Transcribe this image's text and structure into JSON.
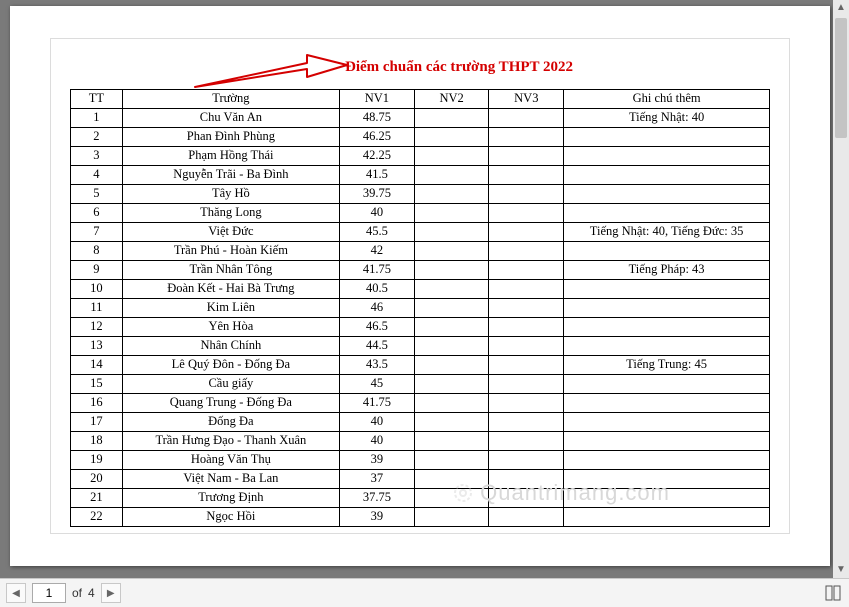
{
  "title": "Điểm chuẩn các trường THPT 2022",
  "headers": {
    "tt": "TT",
    "school": "Trường",
    "nv1": "NV1",
    "nv2": "NV2",
    "nv3": "NV3",
    "note": "Ghi chú thêm"
  },
  "rows": [
    {
      "tt": "1",
      "school": "Chu Văn An",
      "nv1": "48.75",
      "nv2": "",
      "nv3": "",
      "note": "Tiếng Nhật: 40"
    },
    {
      "tt": "2",
      "school": "Phan Đình Phùng",
      "nv1": "46.25",
      "nv2": "",
      "nv3": "",
      "note": ""
    },
    {
      "tt": "3",
      "school": "Phạm Hồng Thái",
      "nv1": "42.25",
      "nv2": "",
      "nv3": "",
      "note": ""
    },
    {
      "tt": "4",
      "school": "Nguyễn Trãi - Ba Đình",
      "nv1": "41.5",
      "nv2": "",
      "nv3": "",
      "note": ""
    },
    {
      "tt": "5",
      "school": "Tây Hồ",
      "nv1": "39.75",
      "nv2": "",
      "nv3": "",
      "note": ""
    },
    {
      "tt": "6",
      "school": "Thăng Long",
      "nv1": "40",
      "nv2": "",
      "nv3": "",
      "note": ""
    },
    {
      "tt": "7",
      "school": "Việt Đức",
      "nv1": "45.5",
      "nv2": "",
      "nv3": "",
      "note": "Tiếng Nhật: 40, Tiếng Đức: 35"
    },
    {
      "tt": "8",
      "school": "Trần Phú - Hoàn Kiếm",
      "nv1": "42",
      "nv2": "",
      "nv3": "",
      "note": ""
    },
    {
      "tt": "9",
      "school": "Trần Nhân Tông",
      "nv1": "41.75",
      "nv2": "",
      "nv3": "",
      "note": "Tiếng Pháp: 43"
    },
    {
      "tt": "10",
      "school": "Đoàn Kết - Hai Bà Trưng",
      "nv1": "40.5",
      "nv2": "",
      "nv3": "",
      "note": ""
    },
    {
      "tt": "11",
      "school": "Kim Liên",
      "nv1": "46",
      "nv2": "",
      "nv3": "",
      "note": ""
    },
    {
      "tt": "12",
      "school": "Yên Hòa",
      "nv1": "46.5",
      "nv2": "",
      "nv3": "",
      "note": ""
    },
    {
      "tt": "13",
      "school": "Nhân Chính",
      "nv1": "44.5",
      "nv2": "",
      "nv3": "",
      "note": ""
    },
    {
      "tt": "14",
      "school": "Lê Quý Đôn - Đống Đa",
      "nv1": "43.5",
      "nv2": "",
      "nv3": "",
      "note": "Tiếng Trung: 45"
    },
    {
      "tt": "15",
      "school": "Cầu giấy",
      "nv1": "45",
      "nv2": "",
      "nv3": "",
      "note": ""
    },
    {
      "tt": "16",
      "school": "Quang Trung - Đống Đa",
      "nv1": "41.75",
      "nv2": "",
      "nv3": "",
      "note": ""
    },
    {
      "tt": "17",
      "school": "Đống Đa",
      "nv1": "40",
      "nv2": "",
      "nv3": "",
      "note": ""
    },
    {
      "tt": "18",
      "school": "Trần Hưng Đạo - Thanh Xuân",
      "nv1": "40",
      "nv2": "",
      "nv3": "",
      "note": ""
    },
    {
      "tt": "19",
      "school": "Hoàng Văn Thụ",
      "nv1": "39",
      "nv2": "",
      "nv3": "",
      "note": ""
    },
    {
      "tt": "20",
      "school": "Việt Nam - Ba Lan",
      "nv1": "37",
      "nv2": "",
      "nv3": "",
      "note": ""
    },
    {
      "tt": "21",
      "school": "Trương Định",
      "nv1": "37.75",
      "nv2": "",
      "nv3": "",
      "note": ""
    },
    {
      "tt": "22",
      "school": "Ngọc Hồi",
      "nv1": "39",
      "nv2": "",
      "nv3": "",
      "note": ""
    }
  ],
  "watermark": "Quantrimang.com",
  "pager": {
    "current": "1",
    "total": "4",
    "of_label": "of"
  }
}
